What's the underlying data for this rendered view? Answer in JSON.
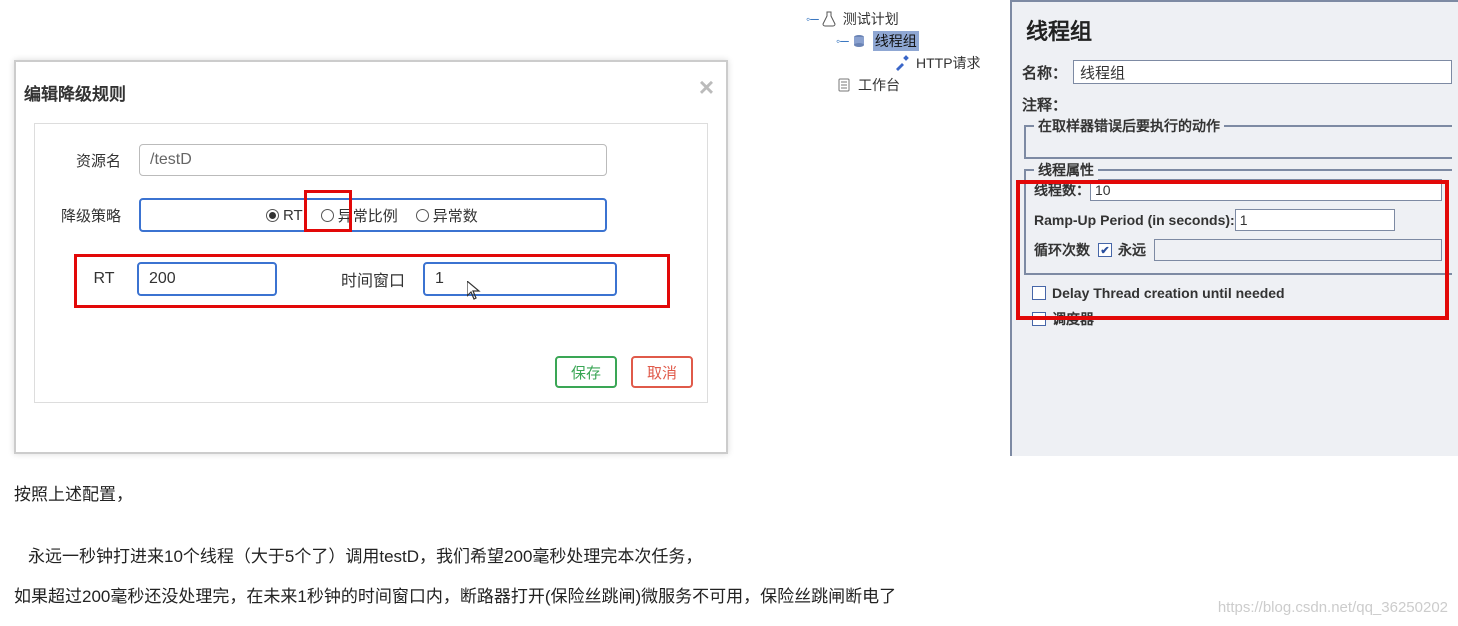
{
  "dialog": {
    "title": "编辑降级规则",
    "close": "×",
    "resource_label": "资源名",
    "resource_value": "/testD",
    "strategy_label": "降级策略",
    "radio_rt": "RT",
    "radio_ratio": "异常比例",
    "radio_count": "异常数",
    "rt_label": "RT",
    "rt_value": "200",
    "window_label": "时间窗口",
    "window_value": "1",
    "save": "保存",
    "cancel": "取消"
  },
  "tree": {
    "root": "测试计划",
    "thread_group": "线程组",
    "http_request": "HTTP请求",
    "workbench": "工作台"
  },
  "right": {
    "title": "线程组",
    "name_label": "名称：",
    "name_value": "线程组",
    "comment_label": "注释：",
    "error_legend": "在取样器错误后要执行的动作",
    "thread_legend": "线程属性",
    "thread_count_label": "线程数：",
    "thread_count_value": "10",
    "rampup_label": "Ramp-Up Period (in seconds):",
    "rampup_value": "1",
    "loop_label": "循环次数",
    "loop_forever": "永远",
    "delay_label": "Delay Thread creation until needed",
    "scheduler_label": "调度器"
  },
  "body": {
    "line1": "按照上述配置，",
    "line2": "永远一秒钟打进来10个线程（大于5个了）调用testD，我们希望200毫秒处理完本次任务，",
    "line3": "如果超过200毫秒还没处理完，在未来1秒钟的时间窗口内，断路器打开(保险丝跳闸)微服务不可用，保险丝跳闸断电了"
  },
  "watermark": "https://blog.csdn.net/qq_36250202"
}
